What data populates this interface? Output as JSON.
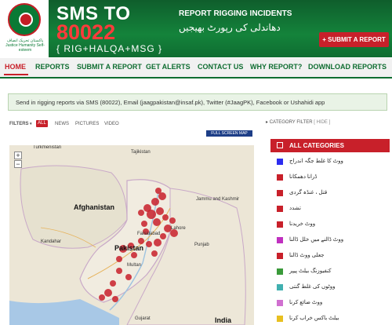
{
  "header": {
    "logo_text": "پاکستان تحریک انصاف\nJustice Humanity Self-esteem",
    "sms_title": "SMS TO",
    "sms_number": "80022",
    "sms_format": "{ RIG+HALQA+MSG }",
    "report_title": "REPORT RIGGING INCIDENTS",
    "report_urdu": "دھاندلی کی رپورٹ بھیجیں",
    "submit_label": "SUBMIT A REPORT",
    "submit_icon": "plus-icon"
  },
  "nav": {
    "items": [
      "HOME",
      "REPORTS",
      "SUBMIT A REPORT",
      "GET ALERTS",
      "CONTACT US",
      "WHY REPORT?",
      "DOWNLOAD REPORTS"
    ],
    "active": "HOME"
  },
  "info_bar": {
    "text": "Send in rigging reports via SMS (80022), Email (jaagpakistan@insaf.pk), Twitter (#JaagPK), Facebook or Ushahidi app"
  },
  "filters": {
    "label": "FILTERS",
    "items": [
      "ALL",
      "NEWS",
      "PICTURES",
      "VIDEO"
    ],
    "active": "ALL"
  },
  "category_filter": {
    "label": "CATEGORY FILTER",
    "hide": "[ HIDE ]"
  },
  "map": {
    "fullscreen_label": "FULL SCREEN MAP",
    "zoom_in": "+",
    "zoom_out": "−",
    "labels": [
      "Turkmenistan",
      "Tajikistan",
      "Afghanistan",
      "Pakistan",
      "India",
      "Jammu and Kashmir",
      "Punjab",
      "Gujarat",
      "Lahore",
      "Faisalabad",
      "Multan",
      "Kandahar"
    ]
  },
  "categories": {
    "all_label": "ALL CATEGORIES",
    "items": [
      {
        "label": "ووٹ کا غلط جگہ اندراج",
        "color": "#2c2cf0"
      },
      {
        "label": "ڈرانا دھمکانا",
        "color": "#c8202a"
      },
      {
        "label": "قتل ، غنڈہ گردی",
        "color": "#c8202a"
      },
      {
        "label": "تشدد",
        "color": "#c8202a"
      },
      {
        "label": "ووٹ خریدنا",
        "color": "#c8202a"
      },
      {
        "label": "ووٹ ڈالنے میں خلل ڈالنا",
        "color": "#c030c0"
      },
      {
        "label": "جعلی ووٹ ڈالنا",
        "color": "#c8202a"
      },
      {
        "label": "کنفیوزنگ بیلٹ پیپر",
        "color": "#3a9a3a"
      },
      {
        "label": "ووٹوں کی غلط گنتی",
        "color": "#40b0b0"
      },
      {
        "label": "ووٹ ضائع کرنا",
        "color": "#d070d0"
      },
      {
        "label": "بیلٹ باکس خراب کرنا",
        "color": "#e8c020"
      }
    ]
  }
}
